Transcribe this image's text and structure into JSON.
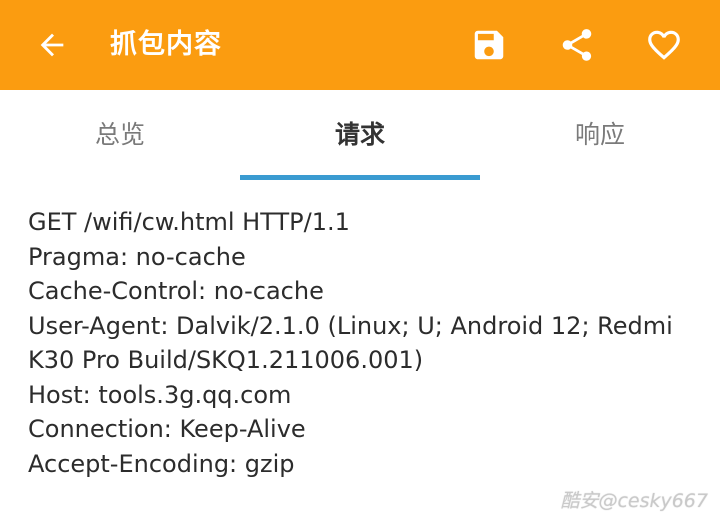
{
  "appbar": {
    "title": "抓包内容",
    "color": "#fb9c10",
    "back_icon": "arrow-left-icon",
    "actions": [
      {
        "name": "save",
        "icon": "floppy-disk-icon"
      },
      {
        "name": "share",
        "icon": "share-icon"
      },
      {
        "name": "favorite",
        "icon": "heart-outline-icon"
      }
    ]
  },
  "tabs": {
    "items": [
      {
        "label": "总览"
      },
      {
        "label": "请求"
      },
      {
        "label": "响应"
      }
    ],
    "active_index": 1,
    "indicator_color": "#3a9bd1"
  },
  "request": {
    "lines": [
      "GET /wifi/cw.html HTTP/1.1",
      "Pragma: no-cache",
      "Cache-Control: no-cache",
      "User-Agent: Dalvik/2.1.0 (Linux; U; Android 12; Redmi",
      "K30 Pro Build/SKQ1.211006.001)",
      "Host: tools.3g.qq.com",
      "Connection: Keep-Alive",
      "Accept-Encoding: gzip"
    ]
  },
  "watermark": "酷安@cesky667"
}
